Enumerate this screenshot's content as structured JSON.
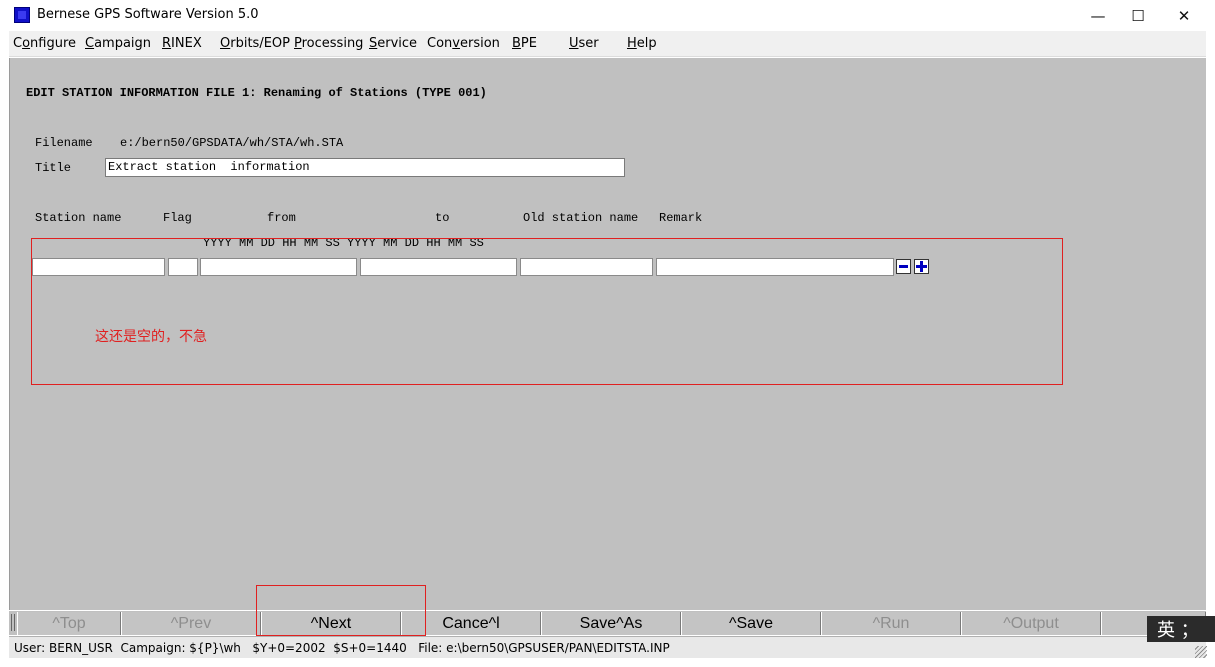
{
  "window": {
    "title": "Bernese GPS Software Version 5.0",
    "minimize_glyph": "—",
    "maximize_glyph": "☐",
    "close_glyph": "✕"
  },
  "menu": {
    "items": [
      {
        "label": "Configure",
        "mnemonic": "o"
      },
      {
        "label": "Campaign",
        "mnemonic": "C"
      },
      {
        "label": "RINEX",
        "mnemonic": "R"
      },
      {
        "label": "Orbits/EOP",
        "mnemonic": "O"
      },
      {
        "label": "Processing",
        "mnemonic": "P"
      },
      {
        "label": "Service",
        "mnemonic": "S"
      },
      {
        "label": "Conversion",
        "mnemonic": "v"
      },
      {
        "label": "BPE",
        "mnemonic": "B"
      },
      {
        "label": "User",
        "mnemonic": "U"
      },
      {
        "label": "Help",
        "mnemonic": "H"
      }
    ]
  },
  "form": {
    "heading": "EDIT STATION INFORMATION FILE 1: Renaming of Stations (TYPE 001)",
    "filename_label": "Filename",
    "filename_value": "e:/bern50/GPSDATA/wh/STA/wh.STA",
    "title_label": "Title",
    "title_value": "Extract station  information",
    "columns": {
      "station_name": "Station name",
      "flag": "Flag",
      "from": "from",
      "to": "to",
      "old_station_name": "Old station name",
      "remark": "Remark"
    },
    "date_format": "YYYY MM DD HH MM SS YYYY MM DD HH MM SS",
    "row": {
      "station_name": "",
      "flag": "",
      "from": "",
      "to": "",
      "old_station_name": "",
      "remark": ""
    }
  },
  "annotation": {
    "text": "这还是空的，不急",
    "color": "#e02020"
  },
  "buttons": [
    {
      "label": "^Top",
      "enabled": false
    },
    {
      "label": "^Prev",
      "enabled": false
    },
    {
      "label": "^Next",
      "enabled": true
    },
    {
      "label": "Cance^l",
      "enabled": true
    },
    {
      "label": "Save^As",
      "enabled": true
    },
    {
      "label": "^Save",
      "enabled": true
    },
    {
      "label": "^Run",
      "enabled": false
    },
    {
      "label": "^Output",
      "enabled": false
    }
  ],
  "status": {
    "text": "User: BERN_USR  Campaign: ${P}\\wh   $Y+0=2002  $S+0=1440   File: e:\\bern50\\GPSUSER/PAN\\EDITSTA.INP"
  },
  "ime": {
    "text": "英 ；"
  }
}
